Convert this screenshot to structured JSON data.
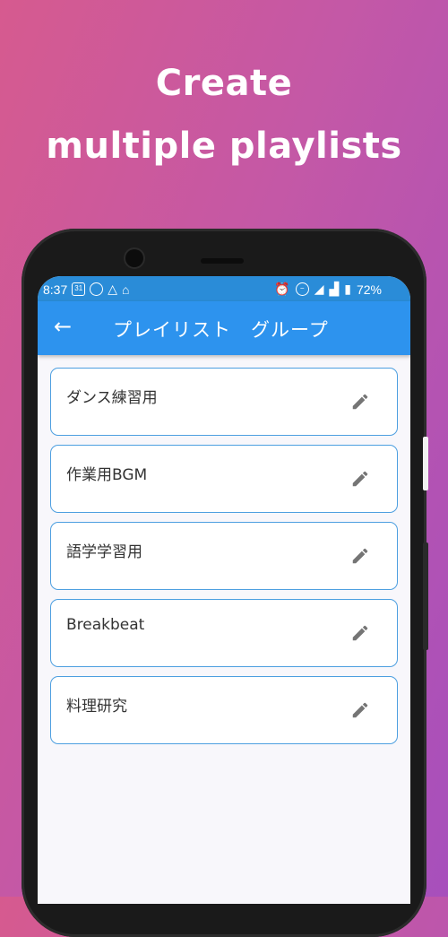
{
  "headline": {
    "line1": "Create",
    "line2": "multiple playlists"
  },
  "statusbar": {
    "time": "8:37",
    "battery": "72%"
  },
  "appbar": {
    "title": "プレイリスト　グループ",
    "back_icon": "arrow-back-icon"
  },
  "groups": [
    {
      "label": "ダンス練習用"
    },
    {
      "label": "作業用BGM"
    },
    {
      "label": "語学学習用"
    },
    {
      "label": "Breakbeat"
    },
    {
      "label": "料理研究"
    }
  ],
  "colors": {
    "appbar": "#2d93ee",
    "statusbar": "#2a8cd8",
    "card_border": "#4d9fe0",
    "edit_icon": "#757575"
  }
}
